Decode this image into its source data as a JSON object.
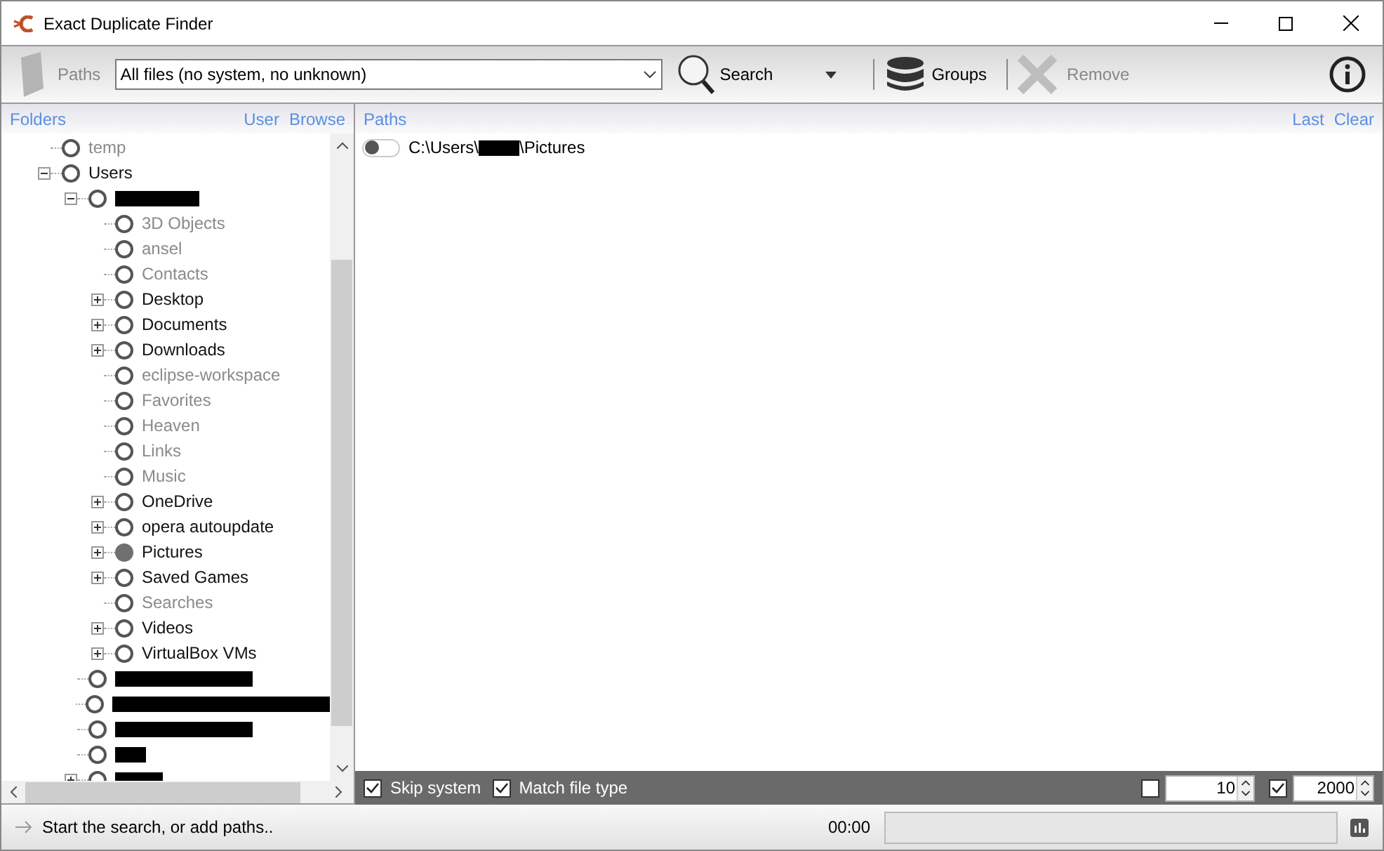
{
  "window": {
    "title": "Exact Duplicate Finder"
  },
  "toolbar": {
    "paths_button": {
      "label": "Paths",
      "disabled": true
    },
    "filter": {
      "value": "All files (no system, no unknown)"
    },
    "search_button": {
      "label": "Search"
    },
    "groups_button": {
      "label": "Groups",
      "disabled": false
    },
    "remove_button": {
      "label": "Remove",
      "disabled": true
    }
  },
  "folders_panel": {
    "title": "Folders",
    "links": [
      "User",
      "Browse"
    ],
    "tree": [
      {
        "kind": "folder",
        "label": "temp",
        "dim": true,
        "checked": false
      },
      {
        "kind": "folder",
        "label": "Users",
        "dim": false,
        "checked": false,
        "expanded": true,
        "children": [
          {
            "kind": "redacted",
            "checked": false,
            "expanded": true,
            "children": [
              {
                "kind": "folder",
                "label": "3D Objects",
                "dim": true,
                "checked": false
              },
              {
                "kind": "folder",
                "label": "ansel",
                "dim": true,
                "checked": false
              },
              {
                "kind": "folder",
                "label": "Contacts",
                "dim": true,
                "checked": false
              },
              {
                "kind": "folder",
                "label": "Desktop",
                "dim": false,
                "checked": false,
                "expanded": false
              },
              {
                "kind": "folder",
                "label": "Documents",
                "dim": false,
                "checked": false,
                "expanded": false
              },
              {
                "kind": "folder",
                "label": "Downloads",
                "dim": false,
                "checked": false,
                "expanded": false
              },
              {
                "kind": "folder",
                "label": "eclipse-workspace",
                "dim": true,
                "checked": false
              },
              {
                "kind": "folder",
                "label": "Favorites",
                "dim": true,
                "checked": false
              },
              {
                "kind": "folder",
                "label": "Heaven",
                "dim": true,
                "checked": false
              },
              {
                "kind": "folder",
                "label": "Links",
                "dim": true,
                "checked": false
              },
              {
                "kind": "folder",
                "label": "Music",
                "dim": true,
                "checked": false
              },
              {
                "kind": "folder",
                "label": "OneDrive",
                "dim": false,
                "checked": false,
                "expanded": false
              },
              {
                "kind": "folder",
                "label": "opera autoupdate",
                "dim": false,
                "checked": false,
                "expanded": false
              },
              {
                "kind": "folder",
                "label": "Pictures",
                "dim": false,
                "checked": true,
                "expanded": false
              },
              {
                "kind": "folder",
                "label": "Saved Games",
                "dim": false,
                "checked": false,
                "expanded": false
              },
              {
                "kind": "folder",
                "label": "Searches",
                "dim": true,
                "checked": false
              },
              {
                "kind": "folder",
                "label": "Videos",
                "dim": false,
                "checked": false,
                "expanded": false
              },
              {
                "kind": "folder",
                "label": "VirtualBox VMs",
                "dim": false,
                "checked": false,
                "expanded": false
              }
            ]
          },
          {
            "kind": "redacted",
            "checked": false
          },
          {
            "kind": "redacted",
            "checked": false
          },
          {
            "kind": "redacted",
            "checked": false
          },
          {
            "kind": "redacted",
            "checked": false
          },
          {
            "kind": "redacted",
            "checked": false,
            "expanded": false
          }
        ]
      }
    ]
  },
  "paths_panel": {
    "title": "Paths",
    "links": [
      "Last",
      "Clear"
    ],
    "paths": [
      {
        "on": false,
        "prefix": "C:\\Users\\",
        "suffix": "\\Pictures"
      }
    ],
    "options": [
      {
        "kind": "check",
        "label": "Skip system",
        "checked": true
      },
      {
        "kind": "check",
        "label": "Match file type",
        "checked": true
      }
    ],
    "limits": [
      {
        "checked": false,
        "value": "10"
      },
      {
        "checked": true,
        "value": "2000"
      }
    ]
  },
  "status_bar": {
    "message": "Start the search, or add paths..",
    "time": "00:00",
    "progress": {
      "level": 0
    }
  }
}
